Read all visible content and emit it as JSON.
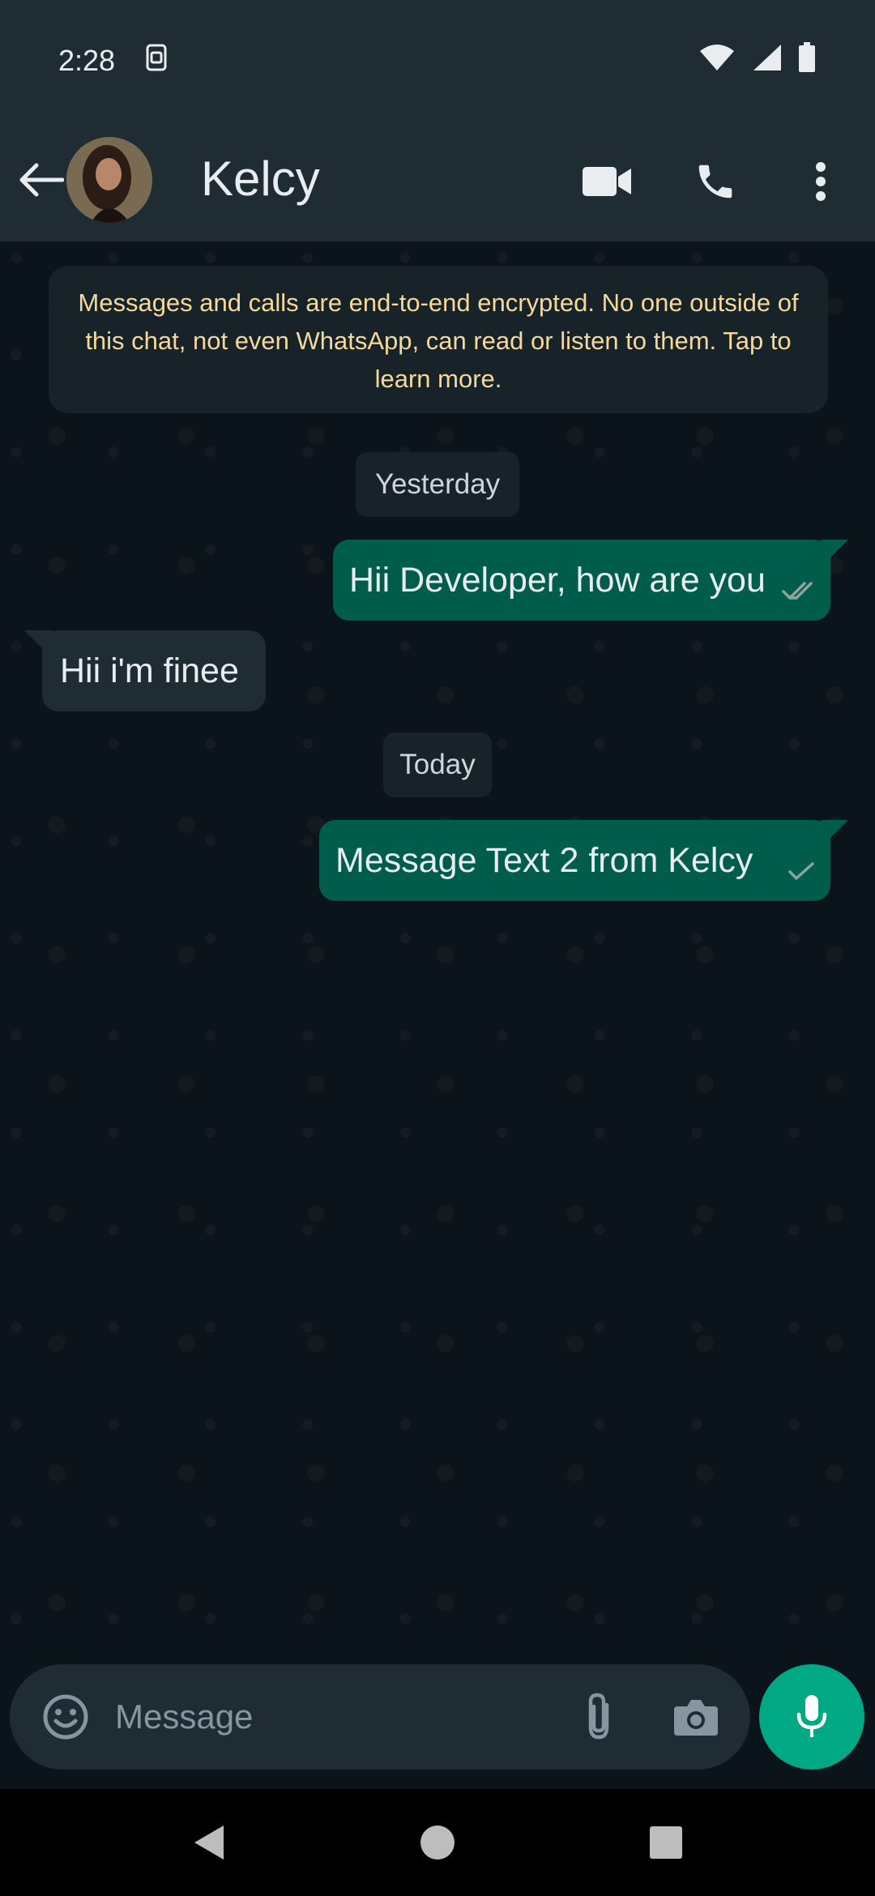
{
  "status_bar": {
    "time": "2:28"
  },
  "header": {
    "contact_name": "Kelcy"
  },
  "chat": {
    "encryption_notice": "Messages and calls are end-to-end encrypted. No one outside of this chat, not even WhatsApp, can read or listen to them. Tap to learn more.",
    "date_dividers": [
      "Yesterday",
      "Today"
    ],
    "messages": [
      {
        "direction": "outgoing",
        "text": "Hii Developer, how are you",
        "status": "read"
      },
      {
        "direction": "incoming",
        "text": "Hii i'm finee"
      },
      {
        "direction": "outgoing",
        "text": "Message Text 2 from Kelcy",
        "status": "sent"
      }
    ]
  },
  "composer": {
    "placeholder": "Message"
  },
  "icons": {
    "status": [
      "sim-icon",
      "wifi-icon",
      "signal-icon",
      "battery-icon"
    ],
    "header": [
      "back-arrow-icon",
      "video-call-icon",
      "phone-icon",
      "more-options-icon"
    ],
    "composer": [
      "emoji-icon",
      "attach-icon",
      "camera-icon",
      "mic-icon"
    ],
    "nav": [
      "nav-back-icon",
      "nav-home-icon",
      "nav-recents-icon"
    ]
  },
  "colors": {
    "header_bg": "#1f2c34",
    "chat_bg": "#0b141a",
    "outgoing_bubble": "#005c4b",
    "incoming_bubble": "#202c33",
    "accent": "#00a884",
    "encryption_text": "#f5d99a",
    "read_tick": "#53bdeb"
  }
}
